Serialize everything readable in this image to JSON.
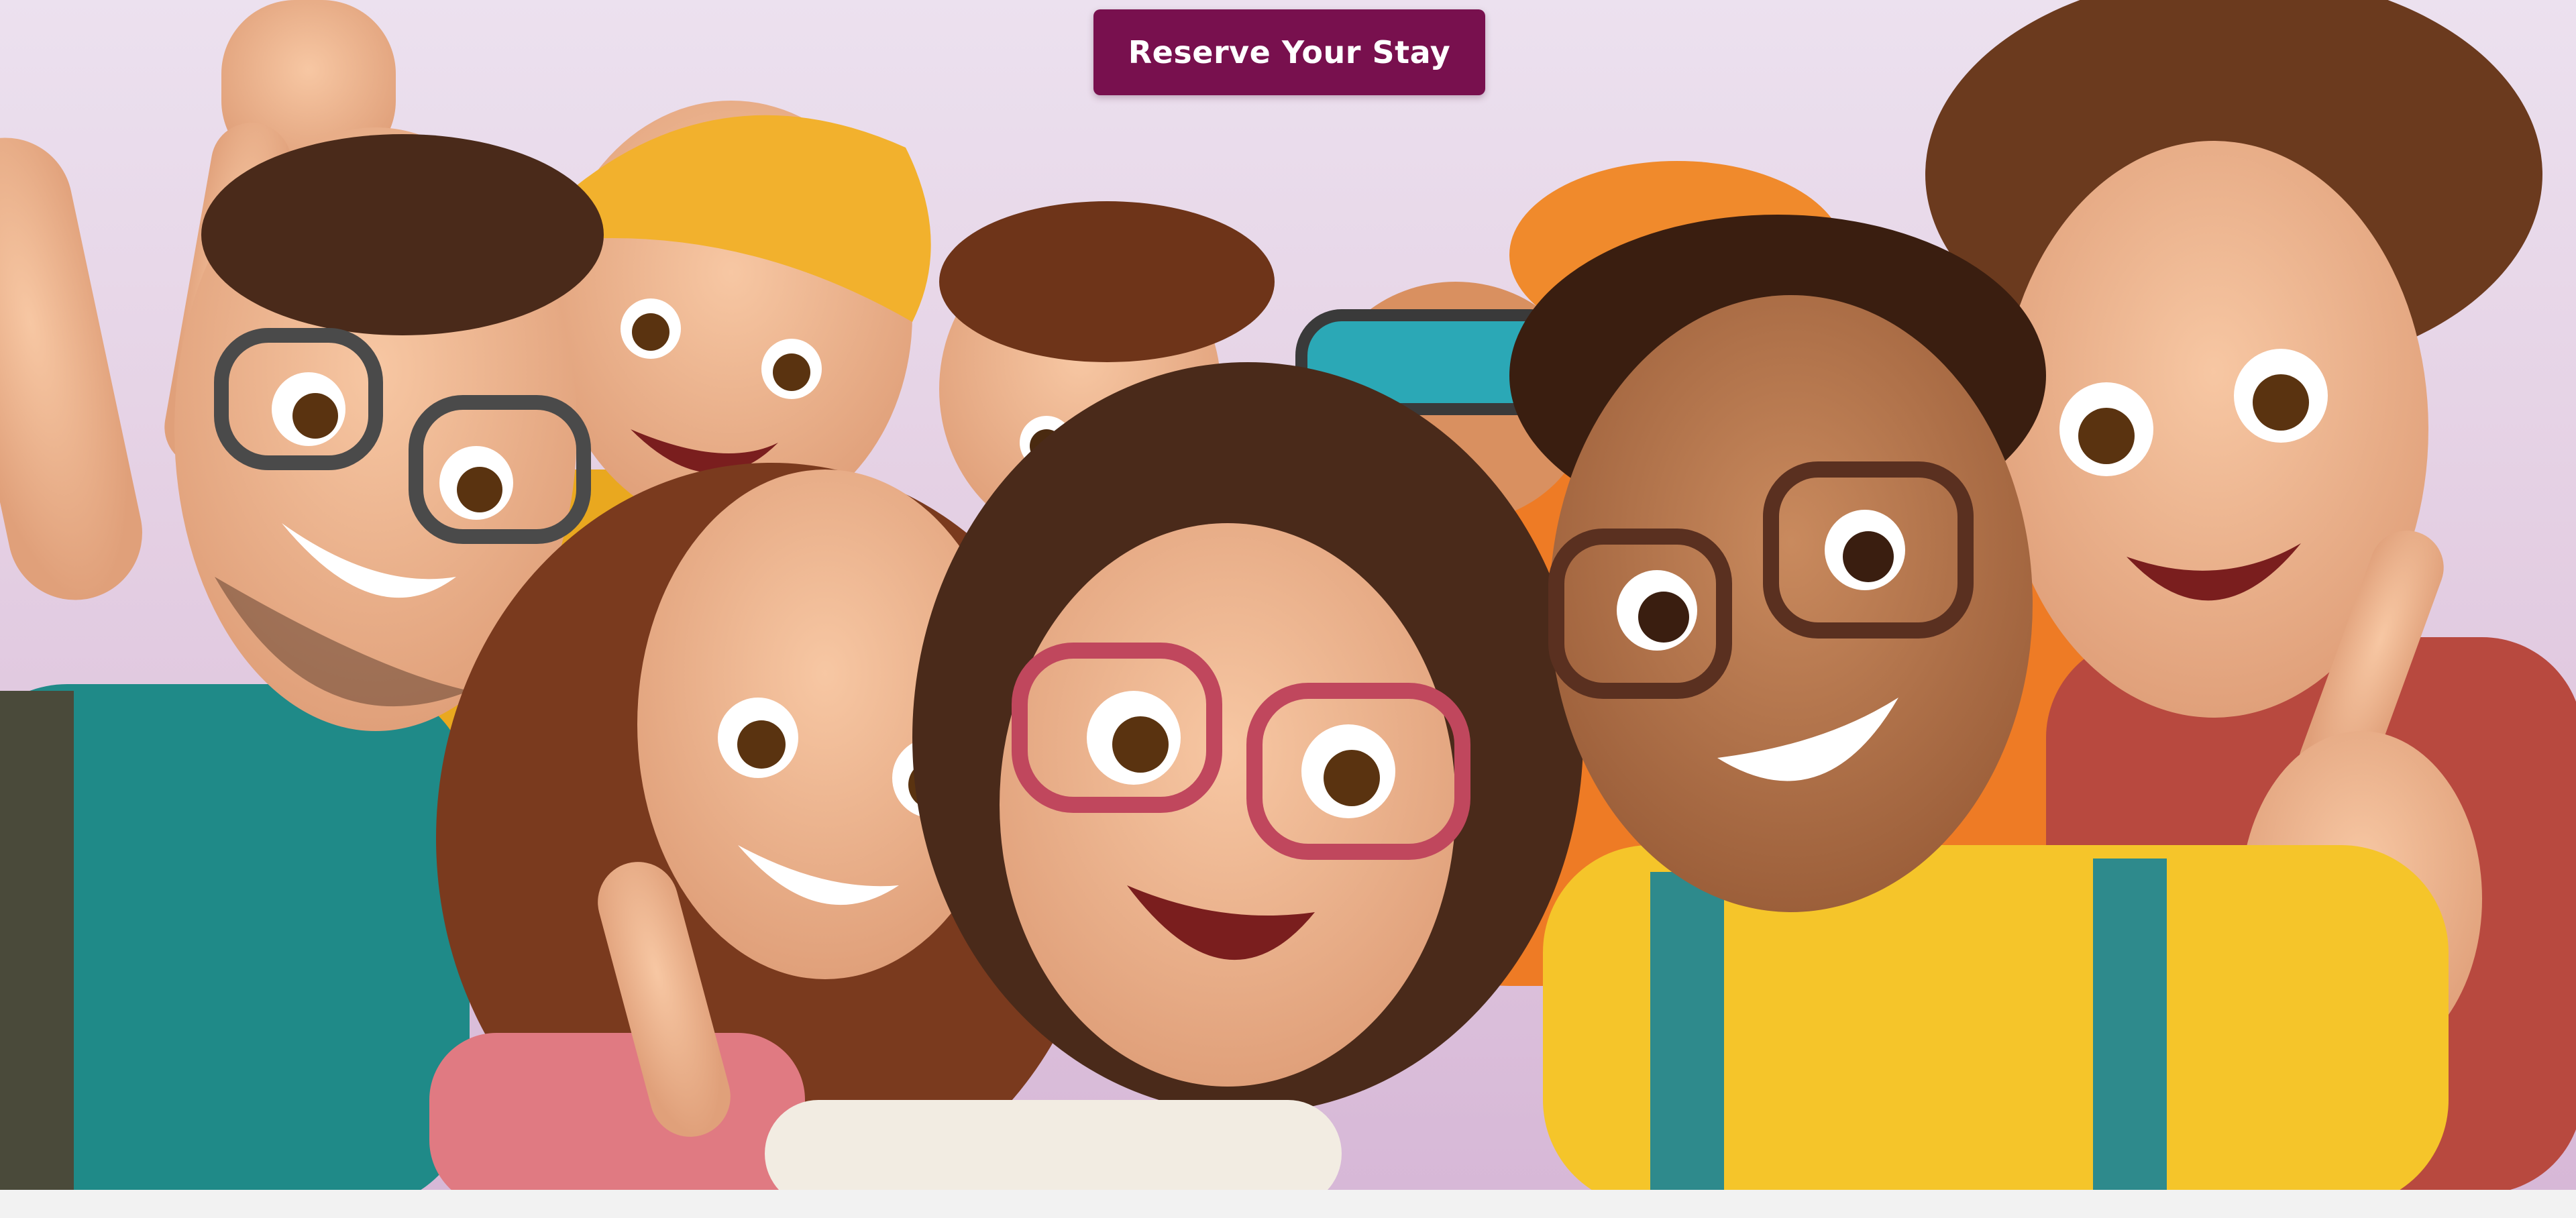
{
  "hero": {
    "cta_label": "Reserve Your Stay",
    "image_alt": "group-selfie-illustration"
  },
  "colors": {
    "cta_bg": "#78104e",
    "cta_text": "#ffffff",
    "page_bg": "#f2f2f2",
    "sky_top": "#ece1ef",
    "sky_bottom": "#d7b8d7"
  }
}
